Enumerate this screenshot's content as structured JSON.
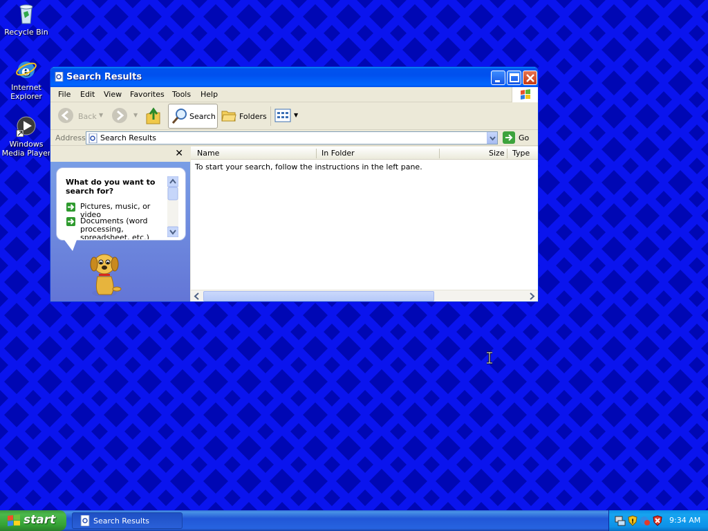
{
  "desktop": {
    "icons": [
      {
        "label": "Recycle Bin",
        "icon": "recycle-bin-icon"
      },
      {
        "label": "Internet Explorer",
        "icon": "internet-explorer-icon"
      },
      {
        "label": "Windows Media Player",
        "icon": "windows-media-player-icon"
      }
    ]
  },
  "window": {
    "title": "Search Results",
    "menu": [
      "File",
      "Edit",
      "View",
      "Favorites",
      "Tools",
      "Help"
    ],
    "toolbar": {
      "back_label": "Back",
      "search_label": "Search",
      "folders_label": "Folders"
    },
    "address": {
      "label": "Address",
      "value": "Search Results",
      "go_label": "Go"
    },
    "left_pane": {
      "close_glyph": "✕",
      "question": "What do you want to search for?",
      "options": [
        {
          "label": "Pictures, music, or video"
        },
        {
          "label": "Documents (word processing, spreadsheet, etc.)"
        }
      ]
    },
    "results": {
      "columns": [
        "Name",
        "In Folder",
        "Size",
        "Type"
      ],
      "hint": "To start your search, follow the instructions in the left pane."
    }
  },
  "taskbar": {
    "start_label": "start",
    "tasks": [
      {
        "label": "Search Results"
      }
    ],
    "clock": "9:34 AM"
  }
}
